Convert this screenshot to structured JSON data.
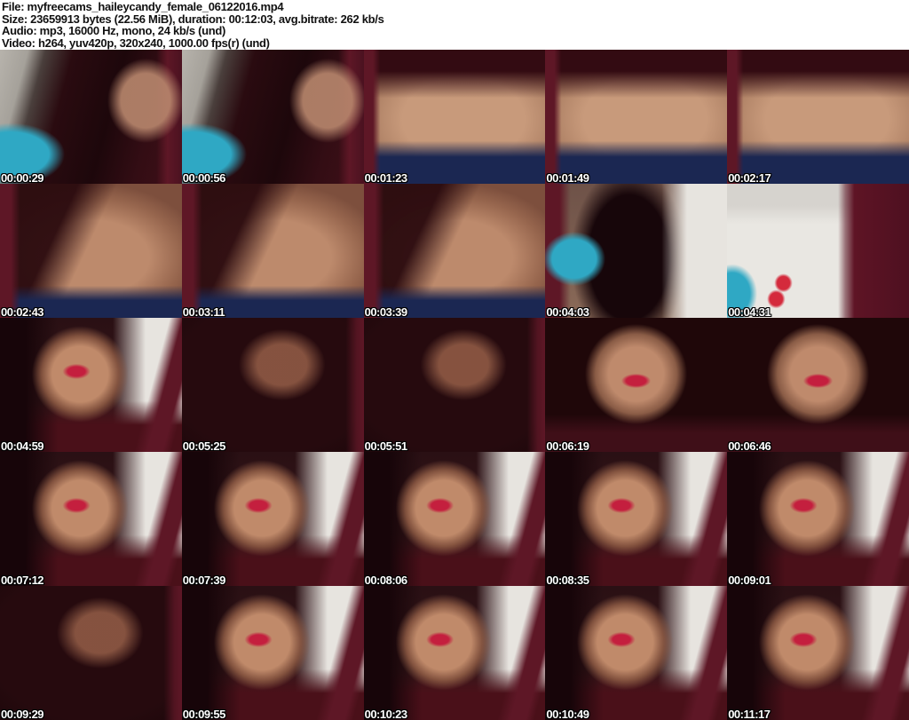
{
  "header": {
    "lines": [
      "File: myfreecams_haileycandy_female_06122016.mp4",
      "Size: 23659913 bytes (22.56 MiB), duration: 00:12:03, avg.bitrate: 262 kb/s",
      "Audio: mp3, 16000 Hz, mono, 24 kb/s (und)",
      "Video: h264, yuv420p, 320x240, 1000.00 fps(r) (und)"
    ]
  },
  "file_info": {
    "filename": "myfreecams_haileycandy_female_06122016.mp4",
    "size_bytes": "23659913",
    "size_human": "22.56 MiB",
    "duration": "00:12:03",
    "avg_bitrate": "262 kb/s",
    "audio_codec": "mp3",
    "audio_sample_rate": "16000 Hz",
    "audio_channels": "mono",
    "audio_bitrate": "24 kb/s",
    "audio_lang": "(und)",
    "video_codec": "h264",
    "pixel_format": "yuv420p",
    "resolution": "320x240",
    "framerate": "1000.00 fps(r)",
    "video_lang": "(und)"
  },
  "grid": {
    "columns": 5,
    "rows": 5
  },
  "colors": {
    "header_bg": "#ffffff",
    "header_text": "#111111",
    "timestamp_text": "#ffffff",
    "timestamp_outline": "#000000",
    "curtain_red": "#5e1726",
    "shirt_maroon": "#3a0d14",
    "underwear_navy": "#1b2752",
    "skin": "#bd8a6c",
    "teal_accent": "#2fa8c4",
    "wall_white": "#e9e7e2",
    "lips_red": "#c41f3e"
  },
  "thumbnails": [
    {
      "timestamp": "00:00:29",
      "tone": "dark-room"
    },
    {
      "timestamp": "00:00:56",
      "tone": "dark-room"
    },
    {
      "timestamp": "00:01:23",
      "tone": "torso"
    },
    {
      "timestamp": "00:01:49",
      "tone": "torso"
    },
    {
      "timestamp": "00:02:17",
      "tone": "torso"
    },
    {
      "timestamp": "00:02:43",
      "tone": "arm"
    },
    {
      "timestamp": "00:03:11",
      "tone": "arm"
    },
    {
      "timestamp": "00:03:39",
      "tone": "arm"
    },
    {
      "timestamp": "00:04:03",
      "tone": "figure-room"
    },
    {
      "timestamp": "00:04:31",
      "tone": "room"
    },
    {
      "timestamp": "00:04:59",
      "tone": "face-wall"
    },
    {
      "timestamp": "00:05:25",
      "tone": "dark-face"
    },
    {
      "timestamp": "00:05:51",
      "tone": "dark-face"
    },
    {
      "timestamp": "00:06:19",
      "tone": "face-dark"
    },
    {
      "timestamp": "00:06:46",
      "tone": "face-dark"
    },
    {
      "timestamp": "00:07:12",
      "tone": "face-wall"
    },
    {
      "timestamp": "00:07:39",
      "tone": "face-wall"
    },
    {
      "timestamp": "00:08:06",
      "tone": "face-wall"
    },
    {
      "timestamp": "00:08:35",
      "tone": "face-wall"
    },
    {
      "timestamp": "00:09:01",
      "tone": "face-wall"
    },
    {
      "timestamp": "00:09:29",
      "tone": "dark-face"
    },
    {
      "timestamp": "00:09:55",
      "tone": "face-wall"
    },
    {
      "timestamp": "00:10:23",
      "tone": "face-wall"
    },
    {
      "timestamp": "00:10:49",
      "tone": "face-wall"
    },
    {
      "timestamp": "00:11:17",
      "tone": "face-wall"
    }
  ]
}
